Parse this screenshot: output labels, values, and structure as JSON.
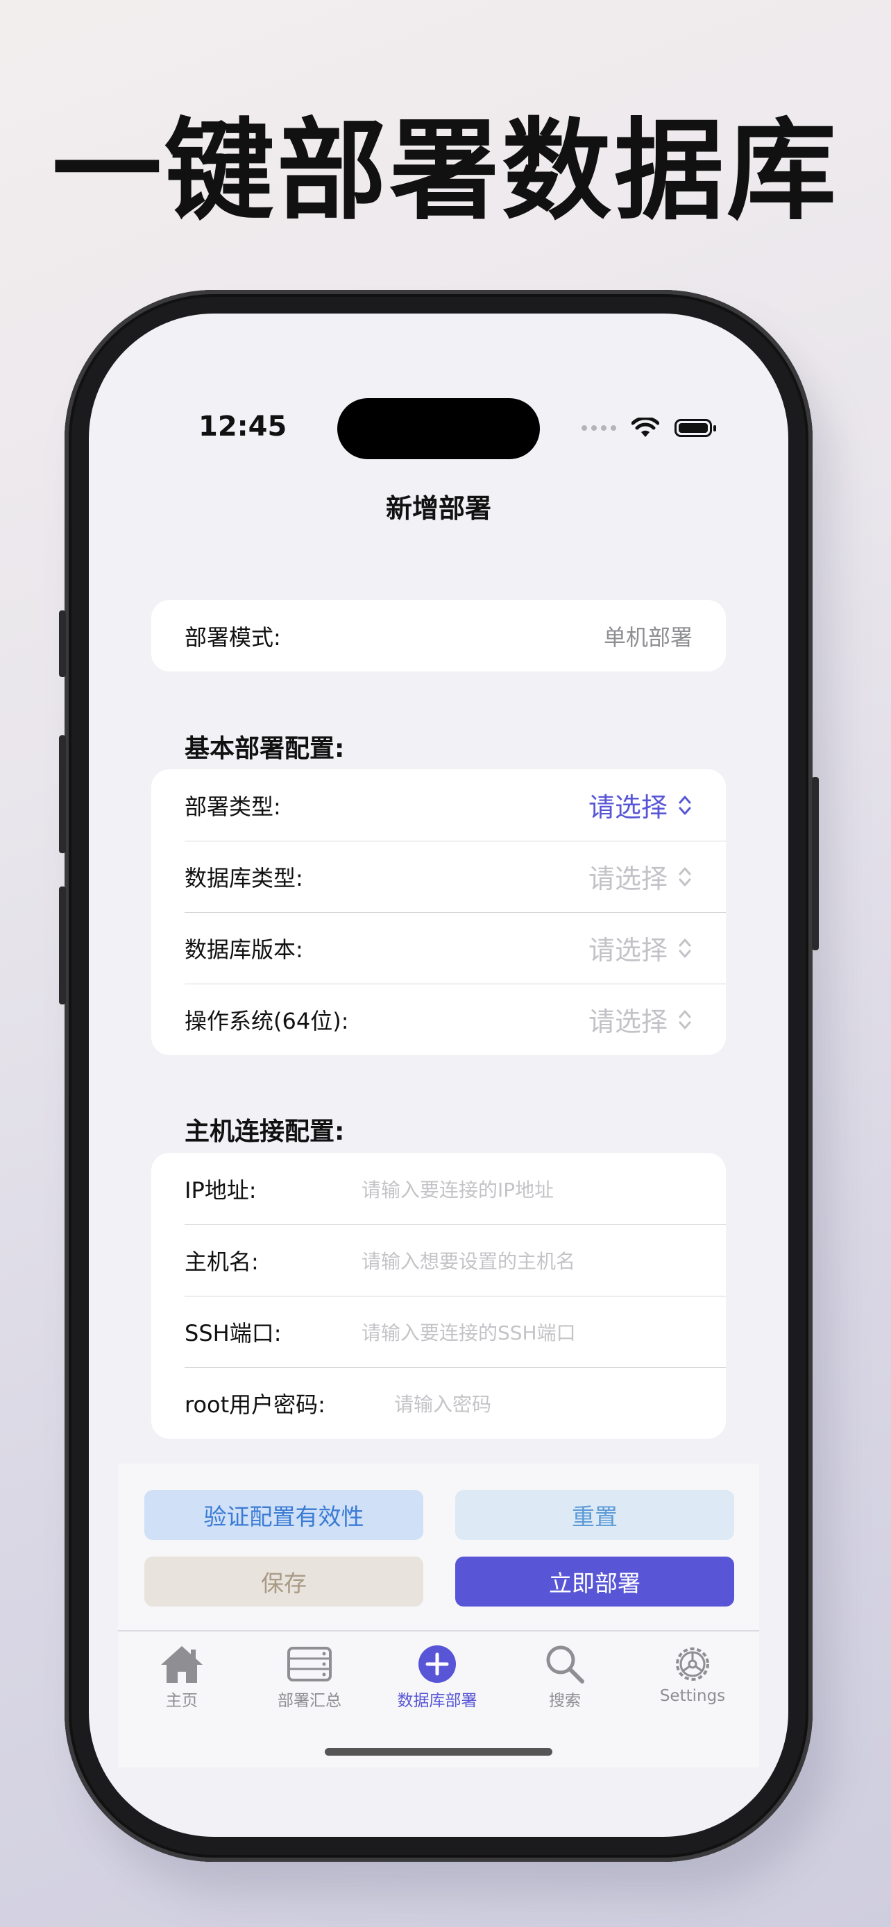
{
  "headline": "一键部署数据库",
  "status_bar": {
    "time": "12:45"
  },
  "nav": {
    "title": "新增部署"
  },
  "deploy_mode": {
    "label": "部署模式:",
    "value": "单机部署"
  },
  "basic_config": {
    "title": "基本部署配置:",
    "rows": [
      {
        "label": "部署类型:",
        "value": "请选择"
      },
      {
        "label": "数据库类型:",
        "value": "请选择"
      },
      {
        "label": "数据库版本:",
        "value": "请选择"
      },
      {
        "label": "操作系统(64位):",
        "value": "请选择"
      }
    ]
  },
  "host_config": {
    "title": "主机连接配置:",
    "rows": [
      {
        "label": "IP地址:",
        "placeholder": "请输入要连接的IP地址"
      },
      {
        "label": "主机名:",
        "placeholder": "请输入想要设置的主机名"
      },
      {
        "label": "SSH端口:",
        "placeholder": "请输入要连接的SSH端口"
      },
      {
        "label": "root用户密码:",
        "placeholder": "请输入密码"
      }
    ]
  },
  "actions": {
    "validate": "验证配置有效性",
    "reset": "重置",
    "save": "保存",
    "deploy": "立即部署"
  },
  "tabs": [
    {
      "label": "主页",
      "icon": "house-icon"
    },
    {
      "label": "部署汇总",
      "icon": "server-icon"
    },
    {
      "label": "数据库部署",
      "icon": "plus-circle-icon"
    },
    {
      "label": "搜索",
      "icon": "search-icon"
    },
    {
      "label": "Settings",
      "icon": "gear-icon"
    }
  ],
  "colors": {
    "accent": "#5856d6",
    "validate_bg": "#cfe0f7",
    "validate_text": "#3a7bd5",
    "reset_bg": "#dde9f5",
    "reset_text": "#5a9bd8",
    "save_bg": "#e8e3dc",
    "save_text": "#a99a86"
  }
}
